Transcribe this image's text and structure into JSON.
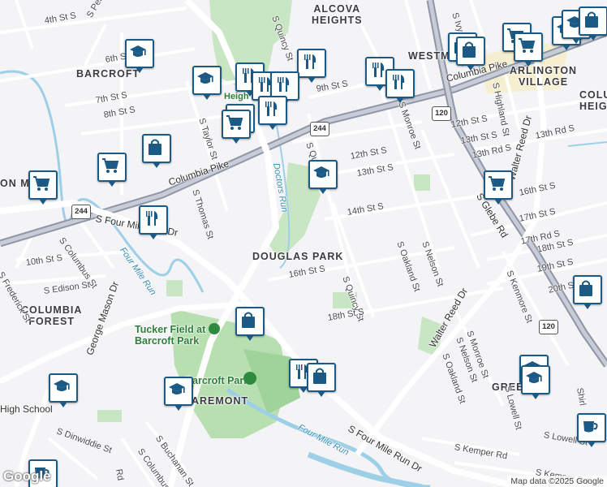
{
  "neighborhoods": [
    {
      "name": "alcova-heights",
      "text": "ALCOVA\nHEIGHTS"
    },
    {
      "name": "westmont",
      "text": "WESTM"
    },
    {
      "name": "barcroft",
      "text": "BARCROFT"
    },
    {
      "name": "douglas-park",
      "text": "DOUGLAS PARK"
    },
    {
      "name": "columbia-forest",
      "text": "COLUMBIA\nFOREST"
    },
    {
      "name": "arlington-village",
      "text": "ARLINGTON\nVILLAGE"
    },
    {
      "name": "columbia-heights-partial",
      "text": "COLU\nHEIG"
    },
    {
      "name": "claremont-partial",
      "text": "AREMONT"
    },
    {
      "name": "green-valley-partial",
      "text": "GREEN VA"
    },
    {
      "name": "heights-partial",
      "text": "Heigh"
    },
    {
      "name": "columbia-mills-partial",
      "text": "ON M"
    }
  ],
  "streets": [
    "4th St S",
    "S Pershing",
    "6th St S",
    "7th St S",
    "8th St S",
    "9th St S",
    "S Quincy St",
    "10th St S",
    "12th St S",
    "13th St S",
    "13th Rd S",
    "14th St S",
    "16th St S",
    "17th St S",
    "17th Rd S",
    "18th St S",
    "19th St S",
    "20th St S",
    "Columbia Pike",
    "S Four Mile Run Dr",
    "Four Mile Run Dr",
    "S Columbus St",
    "S Frederick St",
    "S Edison St",
    "George Mason Dr",
    "S Buchanan St",
    "S Dinwiddie St",
    "S Taylor St",
    "S Thomas St",
    "S Monroe St",
    "S Oakland St",
    "S Nelson St",
    "S Glebe Rd",
    "Walter Reed Dr",
    "S Highland St",
    "S Kemper Rd",
    "S Lowell St",
    "S Kenmore St",
    "S Ivy St",
    "Shirl",
    "Rd"
  ],
  "water_labels": [
    "Doctors Run",
    "Four Mile Run"
  ],
  "parks": [
    "Tucker Field at Barcroft Park",
    "Barcroft Park"
  ],
  "schools": [
    "High School"
  ],
  "route_shields": [
    "244",
    "244",
    "120",
    "120"
  ],
  "pin_icons": [
    "school-icon",
    "fork-knife-icon",
    "shopping-bag-icon",
    "shopping-cart-icon",
    "coffee-icon",
    "info-icon"
  ],
  "logo": "Google",
  "attribution": "Map data ©2025 Google"
}
